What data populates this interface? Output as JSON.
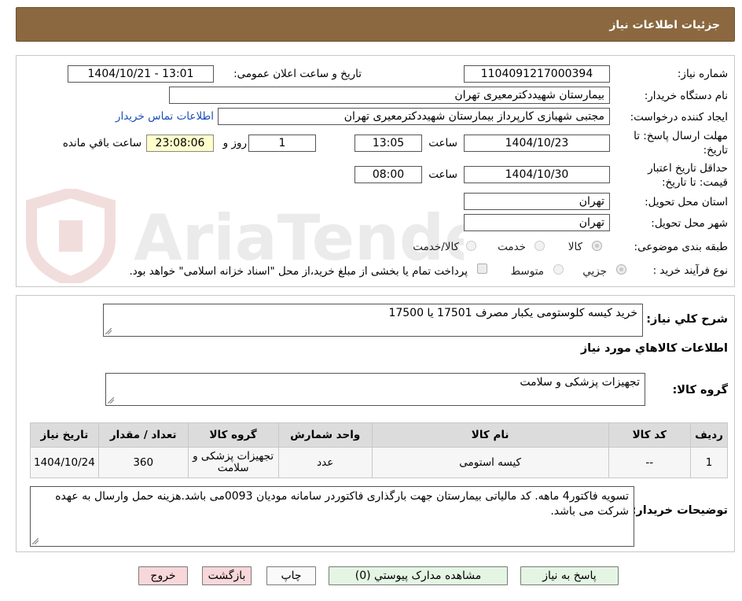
{
  "header": {
    "title": "جزئیات اطلاعات نیاز"
  },
  "watermark": {
    "text": "AriaTender.neT"
  },
  "form": {
    "need_number": {
      "label": "شماره نیاز:",
      "value": "1104091217000394"
    },
    "announce_date": {
      "label": "تاریخ و ساعت اعلان عمومی:",
      "value": "1404/10/21 - 13:01"
    },
    "buyer_org": {
      "label": "نام دستگاه خریدار:",
      "value": "بیمارستان شهیددکترمعیری تهران"
    },
    "requester": {
      "label": "ایجاد کننده درخواست:",
      "value": "مجتبی  شهبازی کارپرداز بیمارستان شهیددکترمعیری تهران"
    },
    "contact_link": "اطلاعات تماس خریدار",
    "reply_deadline": {
      "label": "مهلت ارسال پاسخ: تا تاریخ:",
      "date": "1404/10/23",
      "time_label": "ساعت",
      "time": "13:05",
      "days": "1",
      "days_label": "روز و",
      "remaining": "23:08:06",
      "remaining_label": "ساعت باقي مانده"
    },
    "price_validity": {
      "label": "حداقل تاریخ اعتبار قیمت: تا تاریخ:",
      "date": "1404/10/30",
      "time_label": "ساعت",
      "time": "08:00"
    },
    "province": {
      "label": "استان محل تحویل:",
      "value": "تهران"
    },
    "city": {
      "label": "شهر محل تحویل:",
      "value": "تهران"
    },
    "category": {
      "label": "طبقه بندی موضوعی:",
      "options": [
        "کالا",
        "خدمت",
        "کالا/خدمت"
      ]
    },
    "purchase_type": {
      "label": "نوع فرآیند خرید :",
      "options": [
        "جزیي",
        "متوسط"
      ],
      "note": "پرداخت تمام یا بخشی از مبلغ خرید،از محل \"اسناد خزانه اسلامی\" خواهد بود."
    }
  },
  "summary": {
    "label": "شرح کلي نیاز:",
    "value": "خرید کیسه کلوستومی یکبار مصرف 17501 یا 17500"
  },
  "items_section": {
    "title": "اطلاعات کالاهاي مورد نیاز"
  },
  "goods_group": {
    "label": "گروه کالا:",
    "value": "تجهیزات پزشکی و سلامت"
  },
  "table": {
    "headers": [
      "ردیف",
      "کد کالا",
      "نام کالا",
      "واحد شمارش",
      "گروه کالا",
      "تعداد / مقدار",
      "تاریخ نیاز"
    ],
    "rows": [
      [
        "1",
        "--",
        "کیسه استومی",
        "عدد",
        "تجهیزات پزشکی و سلامت",
        "360",
        "1404/10/24"
      ]
    ]
  },
  "buyer_notes": {
    "label": "توضیحات خریدار:",
    "value": "تسویه فاکتور4 ماهه. کد مالیاتی بیمارستان جهت بارگذاری فاکتوردر سامانه مودیان 0093می باشد.هزینه حمل وارسال به عهده شرکت می باشد."
  },
  "buttons": {
    "reply": "پاسخ به نیاز",
    "attachments": "مشاهده مدارک پیوستي (0)",
    "print": "چاپ",
    "back": "بازگشت",
    "exit": "خروج"
  },
  "colors": {
    "header_bg": "#8b6840",
    "highlight_bg": "#ffffcc",
    "link": "#1a4fb8"
  }
}
